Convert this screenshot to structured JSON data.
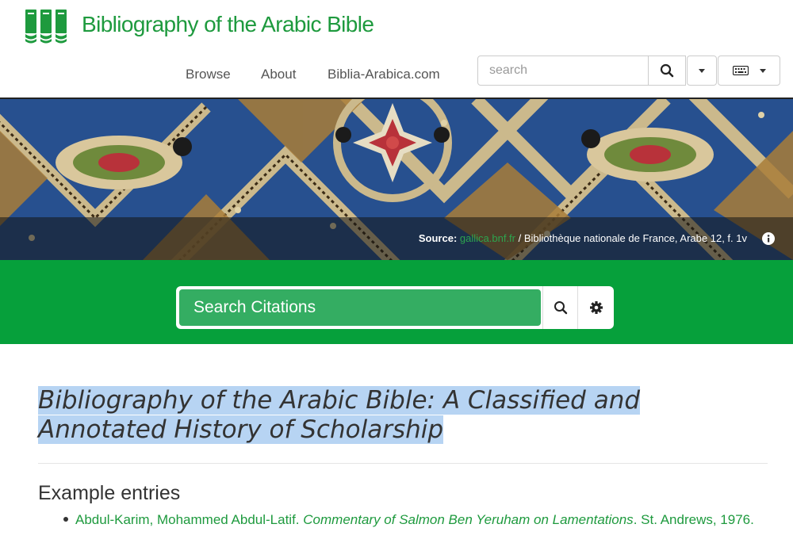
{
  "header": {
    "site_title": "Bibliography of the Arabic Bible",
    "nav": [
      "Browse",
      "About",
      "Biblia-Arabica.com"
    ],
    "search_placeholder": "search",
    "search_icon": "search-icon",
    "dropdown_icon": "caret-down-icon",
    "keyboard_icon": "keyboard-icon"
  },
  "banner": {
    "source_label": "Source:",
    "source_link": "gallica.bnf.fr",
    "source_text": "/ Bibliothèque nationale de France, Arabe 12, f. 1v",
    "info_icon": "info-icon"
  },
  "citation_search": {
    "placeholder": "Search Citations",
    "search_icon": "search-icon",
    "settings_icon": "gear-icon"
  },
  "content": {
    "title_line1": "Bibliography of the Arabic Bible: A Classified and",
    "title_line2": "Annotated History of Scholarship",
    "example_heading": "Example entries",
    "entries": [
      {
        "author": "Abdul-Karim, Mohammed Abdul-Latif.",
        "work": "Commentary of Salmon Ben Yeruham on Lamentations",
        "imprint": ". St. Andrews, 1976."
      }
    ]
  },
  "colors": {
    "brand_green": "#1e9a3e",
    "band_green": "#06a03b",
    "input_green": "#34ad62",
    "title_highlight": "#b7d4f3"
  }
}
